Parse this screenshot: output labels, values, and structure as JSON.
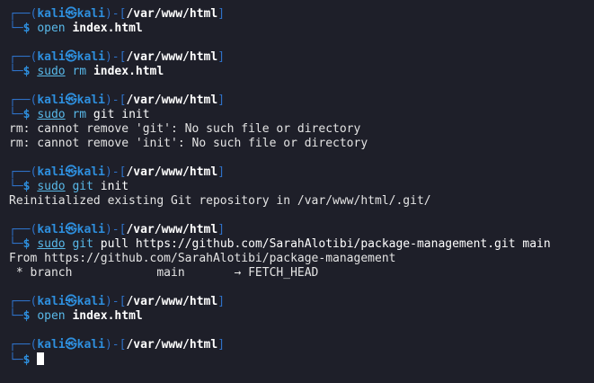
{
  "prompt": {
    "user": "kali",
    "at": "㉿",
    "host": "kali",
    "dir": "/var/www/html",
    "dollar": "$"
  },
  "blocks": [
    {
      "cmd_parts": [
        {
          "t": "open",
          "c": "cmd"
        },
        {
          "t": " ",
          "c": "arg"
        },
        {
          "t": "index.html",
          "c": "argb"
        }
      ],
      "output": []
    },
    {
      "cmd_parts": [
        {
          "t": "sudo",
          "c": "sudo"
        },
        {
          "t": " ",
          "c": "arg"
        },
        {
          "t": "rm",
          "c": "cmd"
        },
        {
          "t": " ",
          "c": "arg"
        },
        {
          "t": "index.html",
          "c": "argb"
        }
      ],
      "output": []
    },
    {
      "cmd_parts": [
        {
          "t": "sudo",
          "c": "sudo"
        },
        {
          "t": " ",
          "c": "arg"
        },
        {
          "t": "rm",
          "c": "cmd"
        },
        {
          "t": " git init",
          "c": "arg"
        }
      ],
      "output": [
        "rm: cannot remove 'git': No such file or directory",
        "rm: cannot remove 'init': No such file or directory"
      ]
    },
    {
      "cmd_parts": [
        {
          "t": "sudo",
          "c": "sudo"
        },
        {
          "t": " ",
          "c": "arg"
        },
        {
          "t": "git",
          "c": "cmd"
        },
        {
          "t": " init",
          "c": "arg"
        }
      ],
      "output": [
        "Reinitialized existing Git repository in /var/www/html/.git/"
      ]
    },
    {
      "cmd_parts": [
        {
          "t": "sudo",
          "c": "sudo"
        },
        {
          "t": " ",
          "c": "arg"
        },
        {
          "t": "git",
          "c": "cmd"
        },
        {
          "t": " pull https://github.com/SarahAlotibi/package-management.git main",
          "c": "arg"
        }
      ],
      "output": [
        "From https://github.com/SarahAlotibi/package-management",
        " * branch            main       → FETCH_HEAD"
      ]
    },
    {
      "cmd_parts": [
        {
          "t": "open",
          "c": "cmd"
        },
        {
          "t": " ",
          "c": "arg"
        },
        {
          "t": "index.html",
          "c": "argb"
        }
      ],
      "output": []
    },
    {
      "cmd_parts": [],
      "output": [],
      "active": true
    }
  ]
}
